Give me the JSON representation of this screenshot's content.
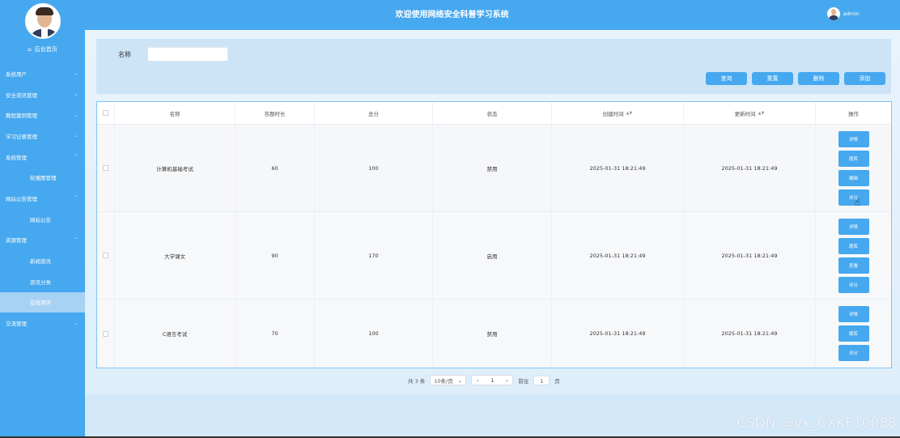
{
  "header": {
    "title": "欢迎使用网络安全科普学习系统",
    "username": "admin"
  },
  "sidebar": {
    "home": "后台首页",
    "items": [
      {
        "label": "系统用户",
        "type": "group",
        "expanded": false
      },
      {
        "label": "安全资讯管理",
        "type": "group",
        "expanded": false
      },
      {
        "label": "教程案例管理",
        "type": "group",
        "expanded": false
      },
      {
        "label": "学习记录管理",
        "type": "group",
        "expanded": false
      },
      {
        "label": "系统管理",
        "type": "group",
        "expanded": true
      },
      {
        "label": "轮播图管理",
        "type": "sub"
      },
      {
        "label": "网站公告管理",
        "type": "group",
        "expanded": true
      },
      {
        "label": "网站公告",
        "type": "sub"
      },
      {
        "label": "资源管理",
        "type": "group",
        "expanded": true
      },
      {
        "label": "新闻资讯",
        "type": "sub"
      },
      {
        "label": "资讯分类",
        "type": "sub"
      },
      {
        "label": "在线测评",
        "type": "sub",
        "active": true
      },
      {
        "label": "交流管理",
        "type": "group",
        "expanded": false
      }
    ]
  },
  "search": {
    "label": "名称",
    "value": "",
    "placeholder": ""
  },
  "actions": {
    "query": "查询",
    "reset": "重置",
    "delete": "删除",
    "add": "添加"
  },
  "table": {
    "headers": {
      "name": "名称",
      "duration": "答题时长",
      "score": "总分",
      "status": "状态",
      "created": "创建时间",
      "updated": "更新时间",
      "ops": "操作"
    },
    "rows": [
      {
        "name": "计算机基础考试",
        "duration": "60",
        "score": "100",
        "status": "禁用",
        "created": "2025-01-31 18:21:49",
        "updated": "2025-01-31 18:21:49",
        "ops": [
          "详情",
          "题库",
          "编辑",
          "评分"
        ]
      },
      {
        "name": "大学课文",
        "duration": "90",
        "score": "170",
        "status": "启用",
        "created": "2025-01-31 18:21:49",
        "updated": "2025-01-31 18:21:49",
        "ops": [
          "详情",
          "题库",
          "查看",
          "评分"
        ]
      },
      {
        "name": "C语言考试",
        "duration": "70",
        "score": "100",
        "status": "禁用",
        "created": "2025-01-31 18:21:49",
        "updated": "2025-01-31 18:21:49",
        "ops": [
          "详情",
          "题库",
          "评分"
        ]
      }
    ]
  },
  "pagination": {
    "total": "共 3 条",
    "page_size": "10条/页",
    "current_page": "1",
    "goto_label": "前往",
    "goto_value": "1",
    "page_suffix": "页"
  },
  "watermark": "CSDN @vx_CXKF10088",
  "colors": {
    "primary": "#46a8ef",
    "active_menu": "#a8d2f4"
  }
}
